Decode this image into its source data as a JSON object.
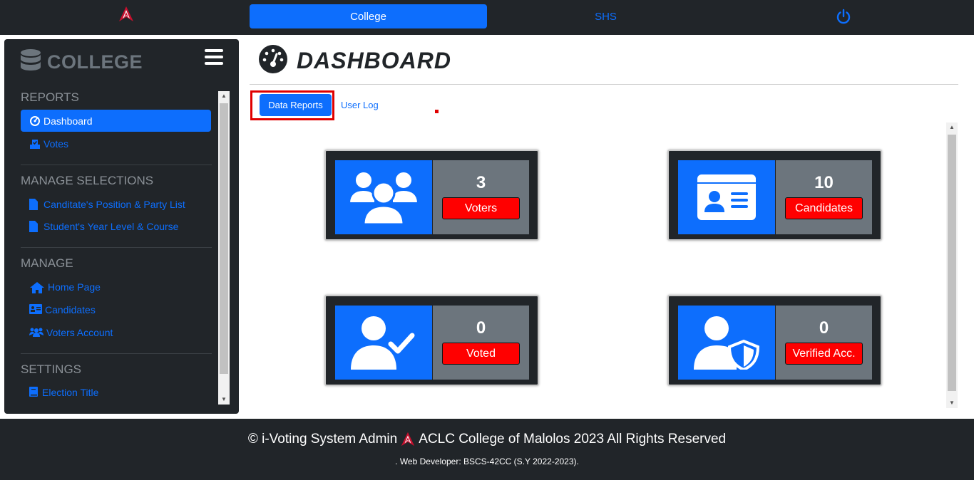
{
  "topbar": {
    "tab_college": "College",
    "tab_shs": "SHS",
    "accent": "#0d6efd"
  },
  "sidebar": {
    "brand": "COLLEGE",
    "sections": {
      "reports": "REPORTS",
      "manage_selections": "MANAGE SELECTIONS",
      "manage": "MANAGE",
      "settings": "SETTINGS"
    },
    "items": {
      "dashboard": "Dashboard",
      "votes": "Votes",
      "position_party": "Canditate's Position & Party List",
      "year_course": "Student's Year Level & Course",
      "home_page": "Home Page",
      "candidates": "Candidates",
      "voters_account": "Voters Account",
      "election_title": "Election Title"
    }
  },
  "main": {
    "title": "DASHBOARD",
    "tabs": {
      "data_reports": "Data Reports",
      "user_log": "User Log"
    },
    "cards": [
      {
        "icon": "users-icon",
        "value": "3",
        "label": "Voters"
      },
      {
        "icon": "id-card-icon",
        "value": "10",
        "label": "Candidates"
      },
      {
        "icon": "user-check-icon",
        "value": "0",
        "label": "Voted"
      },
      {
        "icon": "user-shield-icon",
        "value": "0",
        "label": "Verified Acc."
      }
    ]
  },
  "footer": {
    "line1_left": "© i-Voting System Admin",
    "line1_right": "ACLC College of Malolos 2023 All Rights Reserved",
    "line2": ". Web Developer: BSCS-42CC (S.Y 2022-2023)."
  }
}
